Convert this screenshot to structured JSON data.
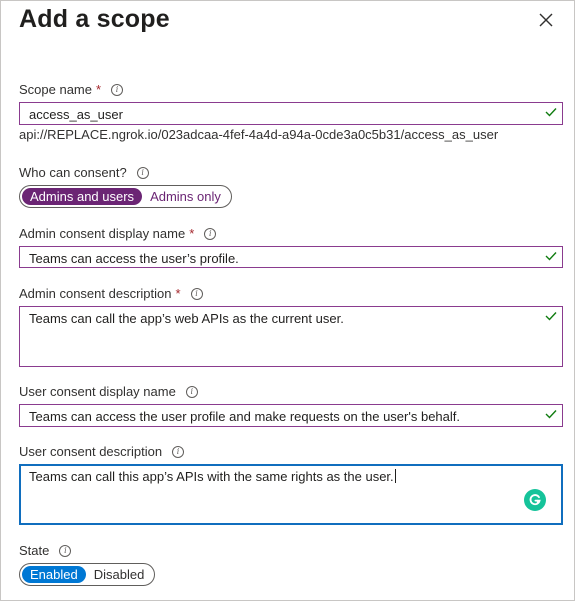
{
  "panel": {
    "title": "Add a scope",
    "close_icon": "close-icon"
  },
  "scope_name": {
    "label": "Scope name",
    "required_mark": "*",
    "value": "access_as_user"
  },
  "scope_uri": "api://REPLACE.ngrok.io/023adcaa-4fef-4a4d-a94a-0cde3a0c5b31/access_as_user",
  "who_can_consent": {
    "label": "Who can consent?",
    "options": [
      "Admins and users",
      "Admins only"
    ],
    "selected": "Admins and users"
  },
  "admin_consent_display_name": {
    "label": "Admin consent display name",
    "required_mark": "*",
    "value": "Teams can access the user’s profile."
  },
  "admin_consent_description": {
    "label": "Admin consent description",
    "required_mark": "*",
    "value": "Teams can call the app’s web APIs as the current user."
  },
  "user_consent_display_name": {
    "label": "User consent display name",
    "value": "Teams can access the user profile and make requests on the user's behalf."
  },
  "user_consent_description": {
    "label": "User consent description",
    "value": "Teams can call this app’s APIs with the same rights as the user."
  },
  "state": {
    "label": "State",
    "options": [
      "Enabled",
      "Disabled"
    ],
    "selected": "Enabled"
  },
  "colors": {
    "field_border": "#8a3b8f",
    "focus_border": "#106ebe",
    "consent_selected": "#6b2574",
    "state_selected": "#0078d4",
    "valid_check": "#107c10",
    "required": "#a4262c",
    "grammarly": "#15c39a"
  },
  "icons": {
    "info": "info-icon",
    "valid": "checkmark-icon",
    "grammarly": "grammarly-icon"
  }
}
